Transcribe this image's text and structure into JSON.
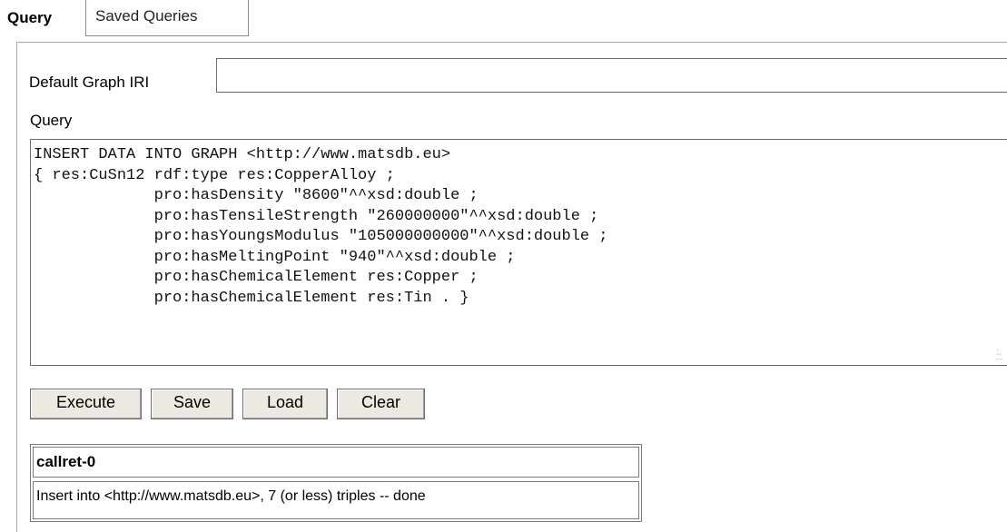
{
  "tabs": {
    "active_label": "Query",
    "saved_label": "Saved Queries"
  },
  "form": {
    "graph_label": "Default Graph IRI",
    "graph_value": "",
    "query_label": "Query",
    "query_text": "INSERT DATA INTO GRAPH <http://www.matsdb.eu>\n{ res:CuSn12 rdf:type res:CopperAlloy ;\n             pro:hasDensity \"8600\"^^xsd:double ;\n             pro:hasTensileStrength \"260000000\"^^xsd:double ;\n             pro:hasYoungsModulus \"105000000000\"^^xsd:double ;\n             pro:hasMeltingPoint \"940\"^^xsd:double ;\n             pro:hasChemicalElement res:Copper ;\n             pro:hasChemicalElement res:Tin . }"
  },
  "buttons": {
    "execute": "Execute",
    "save": "Save",
    "load": "Load",
    "clear": "Clear"
  },
  "result": {
    "column_header": "callret-0",
    "rows": [
      "Insert into <http://www.matsdb.eu>, 7 (or less) triples -- done"
    ]
  },
  "icons": {
    "resize_grip": "resize-grip-icon"
  }
}
